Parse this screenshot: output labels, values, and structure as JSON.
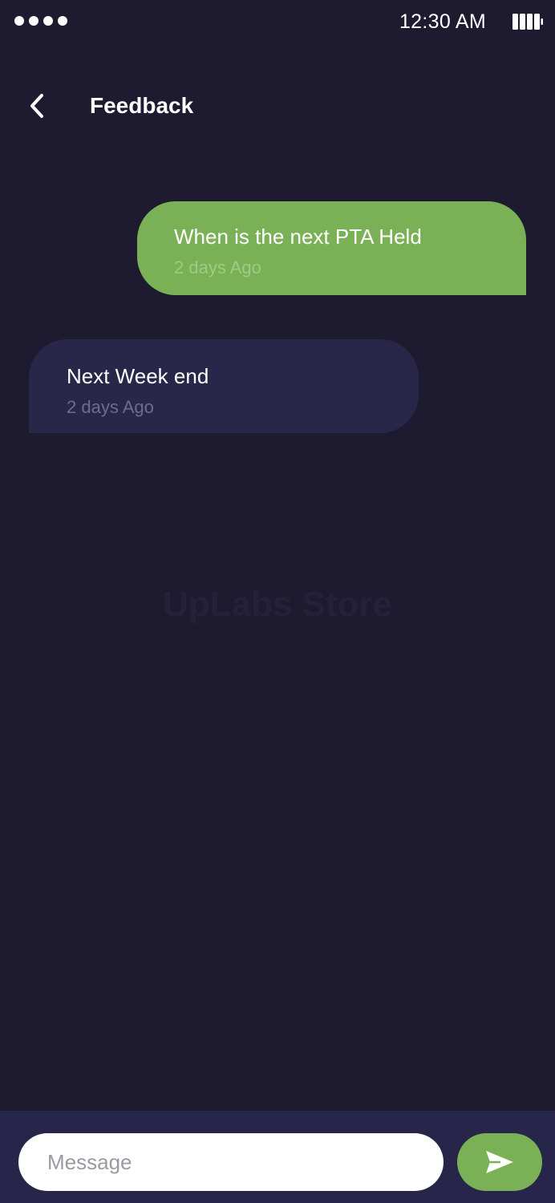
{
  "status_bar": {
    "time": "12:30 AM",
    "signal_icon": "signal-dots-icon",
    "battery_icon": "battery-icon"
  },
  "header": {
    "back_icon": "chevron-left-icon",
    "title": "Feedback"
  },
  "messages": [
    {
      "direction": "sent",
      "text": "When is the next PTA Held",
      "time": "2 days Ago"
    },
    {
      "direction": "received",
      "text": "Next Week end",
      "time": "2 days Ago"
    }
  ],
  "watermark": "UpLabs Store",
  "composer": {
    "placeholder": "Message",
    "value": "",
    "send_icon": "send-icon"
  },
  "colors": {
    "background": "#1e1b30",
    "sent_bubble": "#7ab157",
    "received_bubble": "#282749",
    "composer_bar": "#27264a",
    "accent": "#7ab157"
  }
}
